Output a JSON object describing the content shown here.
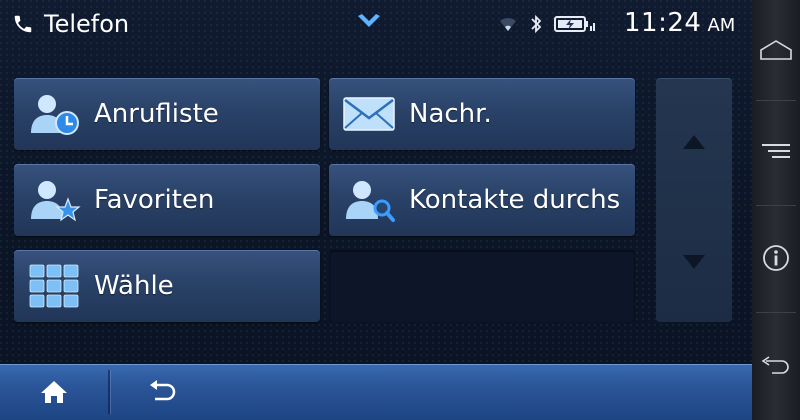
{
  "statusbar": {
    "app_title": "Telefon",
    "time": "11:24",
    "ampm": "AM"
  },
  "tiles": [
    {
      "label": "Anrufliste",
      "icon": "call-log-icon"
    },
    {
      "label": "Nachr.",
      "icon": "envelope-icon"
    },
    {
      "label": "Favoriten",
      "icon": "favorites-icon"
    },
    {
      "label": "Kontakte durchs",
      "icon": "contact-search-icon"
    },
    {
      "label": "Wähle",
      "icon": "dialpad-icon"
    }
  ],
  "colors": {
    "tile": "#2a4268",
    "bottombar": "#2a5598",
    "accent": "#3b8fe0"
  }
}
